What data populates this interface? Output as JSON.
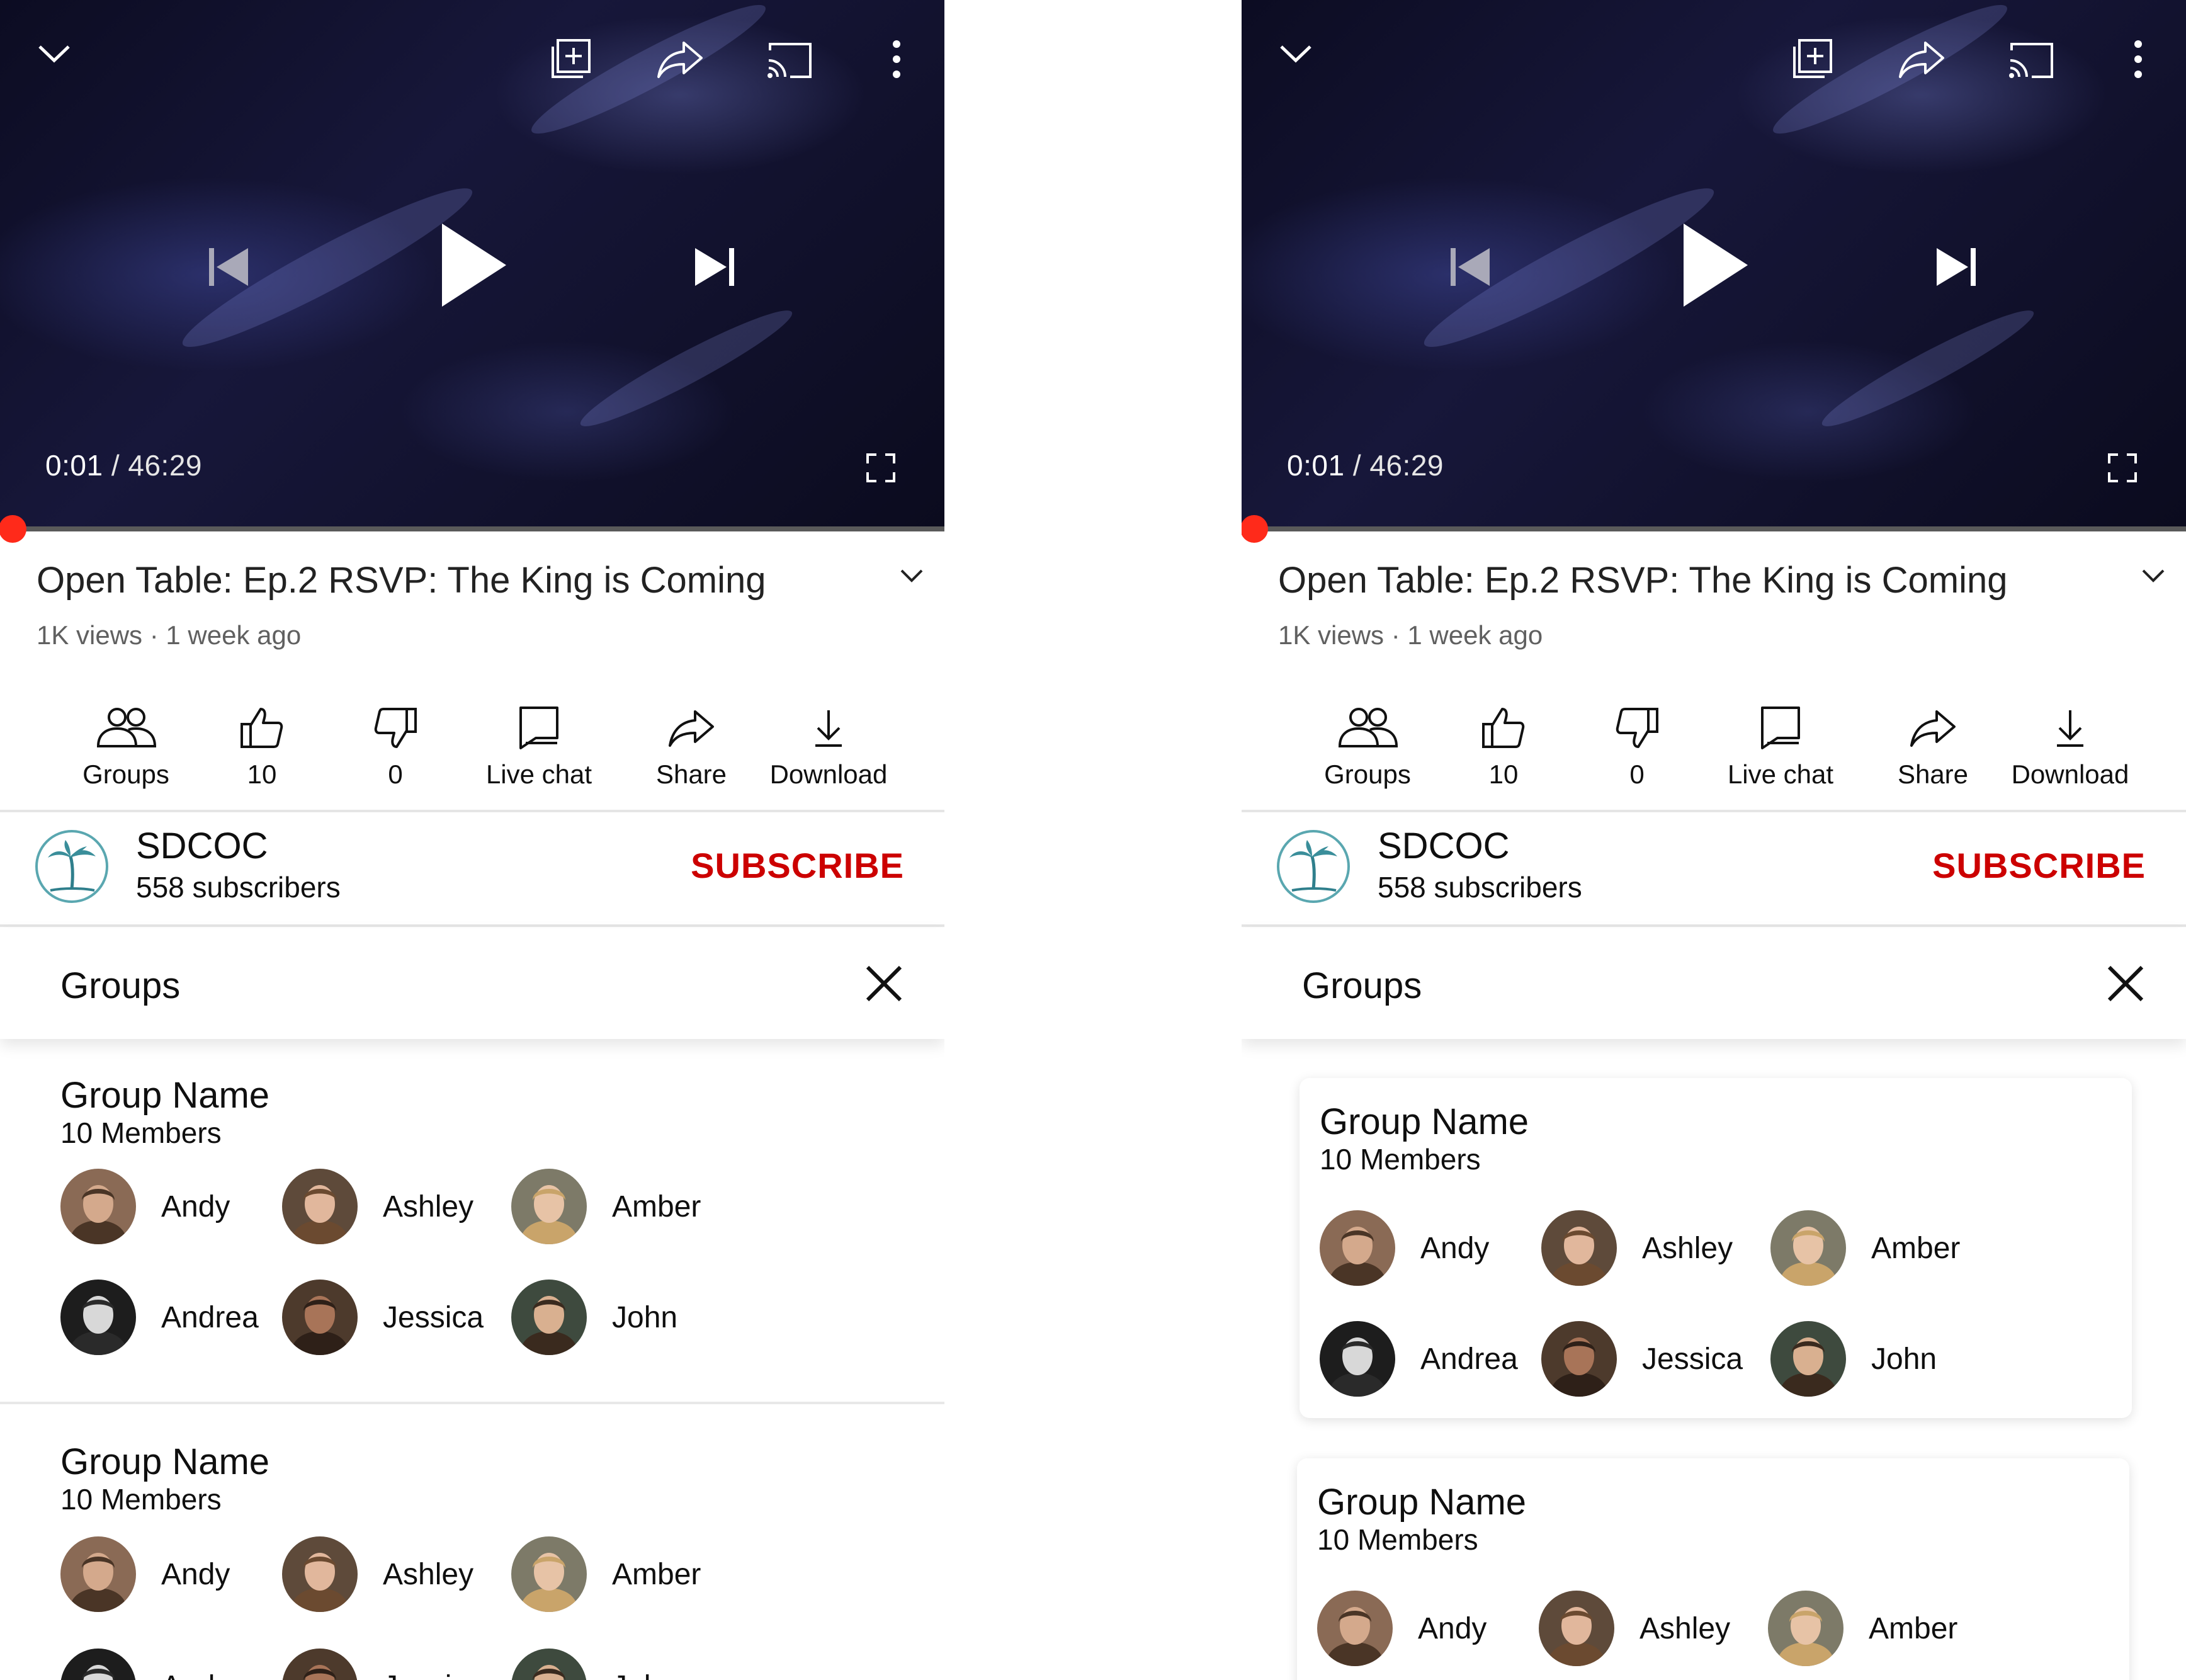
{
  "player": {
    "current_time": "0:01",
    "duration": "/ 46:29",
    "progress_fraction": 0.0004
  },
  "video": {
    "title": "Open Table: Ep.2 RSVP: The King is Coming",
    "meta": "1K views · 1 week ago"
  },
  "actions": [
    {
      "label": "Groups",
      "icon": "groups-icon"
    },
    {
      "label": "10",
      "icon": "thumbs-up-icon"
    },
    {
      "label": "0",
      "icon": "thumbs-down-icon"
    },
    {
      "label": "Live chat",
      "icon": "chat-icon"
    },
    {
      "label": "Share",
      "icon": "share-icon"
    },
    {
      "label": "Download",
      "icon": "download-icon"
    }
  ],
  "channel": {
    "name": "SDCOC",
    "subscribers": "558 subscribers",
    "subscribe_label": "SUBSCRIBE"
  },
  "groups_panel": {
    "title": "Groups",
    "groups": [
      {
        "name": "Group Name",
        "members_count": "10 Members",
        "members": [
          "Andy",
          "Ashley",
          "Amber",
          "Andrea",
          "Jessica",
          "John"
        ]
      },
      {
        "name": "Group Name",
        "members_count": "10 Members",
        "members": [
          "Andy",
          "Ashley",
          "Amber",
          "Andrea",
          "Jessica",
          "John"
        ]
      }
    ]
  },
  "colors": {
    "subscribe": "#cc0000",
    "progress_dot": "#ff2a1a",
    "channel_ring": "#5aa7b0"
  }
}
